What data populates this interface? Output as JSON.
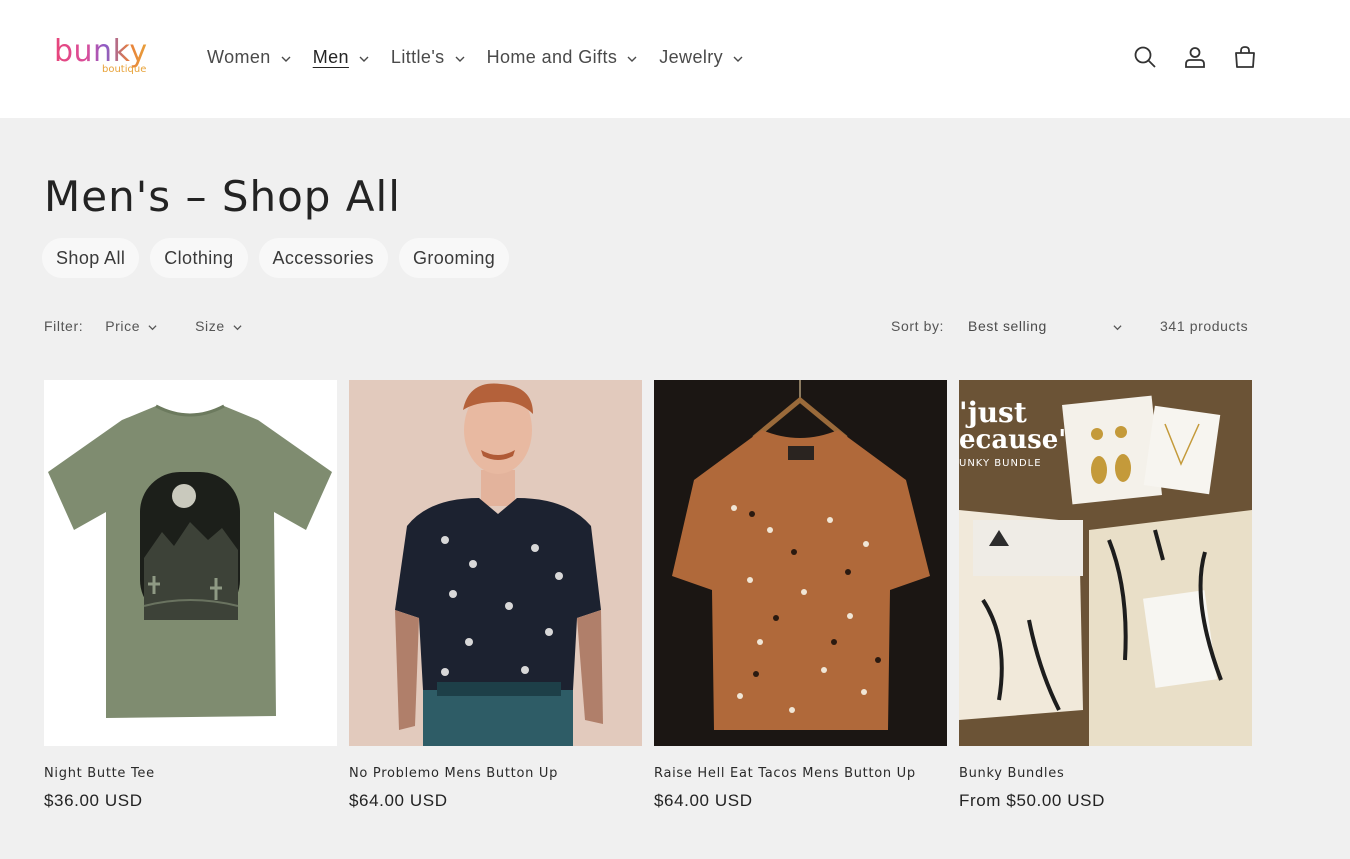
{
  "logo": {
    "main": "bunky",
    "sub": "boutique"
  },
  "nav": [
    {
      "label": "Women",
      "active": false
    },
    {
      "label": "Men",
      "active": true
    },
    {
      "label": "Little's",
      "active": false
    },
    {
      "label": "Home and Gifts",
      "active": false
    },
    {
      "label": "Jewelry",
      "active": false
    }
  ],
  "header_icons": [
    "search-icon",
    "account-icon",
    "cart-icon"
  ],
  "page_title": "Men's – Shop All",
  "pills": [
    "Shop All",
    "Clothing",
    "Accessories",
    "Grooming"
  ],
  "filters": {
    "label": "Filter:",
    "items": [
      "Price",
      "Size"
    ]
  },
  "sort": {
    "label": "Sort by:",
    "value": "Best selling",
    "count": "341 products"
  },
  "products": [
    {
      "name": "Night Butte Tee",
      "price": "$36.00 USD"
    },
    {
      "name": "No Problemo Mens Button Up",
      "price": "$64.00 USD"
    },
    {
      "name": "Raise Hell Eat Tacos Mens Button Up",
      "price": "$64.00 USD"
    },
    {
      "name": "Bunky Bundles",
      "price": "From $50.00 USD"
    }
  ],
  "bundle_image_text": {
    "line1": "'just",
    "line2": "ecause'",
    "line3": "UNKY BUNDLE"
  },
  "colors": {
    "header_bg": "#ffffff",
    "page_bg": "#f0f0f0",
    "text": "#232323"
  }
}
